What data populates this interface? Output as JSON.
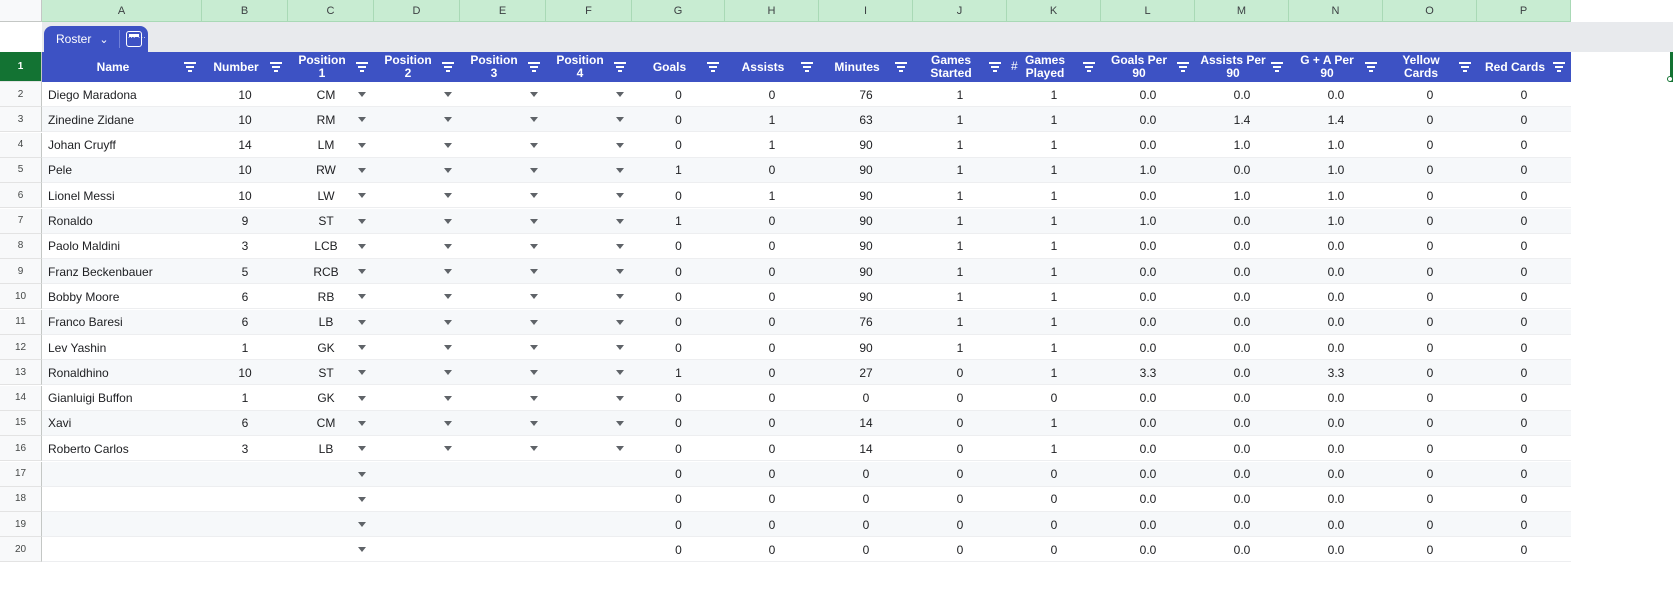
{
  "columns": [
    {
      "letter": "A",
      "header": "Name",
      "width": 160,
      "align": "left"
    },
    {
      "letter": "B",
      "header": "Number",
      "width": 86,
      "align": "center"
    },
    {
      "letter": "C",
      "header": "Position\n1",
      "width": 86,
      "align": "center",
      "dropdown": true
    },
    {
      "letter": "D",
      "header": "Position\n2",
      "width": 86,
      "align": "center",
      "dropdown": true
    },
    {
      "letter": "E",
      "header": "Position\n3",
      "width": 86,
      "align": "center",
      "dropdown": true
    },
    {
      "letter": "F",
      "header": "Position\n4",
      "width": 86,
      "align": "center",
      "dropdown": true
    },
    {
      "letter": "G",
      "header": "Goals",
      "width": 93,
      "align": "center"
    },
    {
      "letter": "H",
      "header": "Assists",
      "width": 94,
      "align": "center"
    },
    {
      "letter": "I",
      "header": "Minutes",
      "width": 94,
      "align": "center"
    },
    {
      "letter": "J",
      "header": "Games\nStarted",
      "width": 94,
      "align": "center"
    },
    {
      "letter": "K",
      "header": "Games\nPlayed",
      "width": 94,
      "align": "center",
      "hash": true
    },
    {
      "letter": "L",
      "header": "Goals Per\n90",
      "width": 94,
      "align": "center"
    },
    {
      "letter": "M",
      "header": "Assists Per\n90",
      "width": 94,
      "align": "center"
    },
    {
      "letter": "N",
      "header": "G + A Per\n90",
      "width": 94,
      "align": "center"
    },
    {
      "letter": "O",
      "header": "Yellow\nCards",
      "width": 94,
      "align": "center"
    },
    {
      "letter": "P",
      "header": "Red Cards",
      "width": 94,
      "align": "center"
    }
  ],
  "table": {
    "name": "Roster"
  },
  "rows": [
    [
      "Diego Maradona",
      "10",
      "CM",
      "",
      "",
      "",
      "0",
      "0",
      "76",
      "1",
      "1",
      "0.0",
      "0.0",
      "0.0",
      "0",
      "0"
    ],
    [
      "Zinedine Zidane",
      "10",
      "RM",
      "",
      "",
      "",
      "0",
      "1",
      "63",
      "1",
      "1",
      "0.0",
      "1.4",
      "1.4",
      "0",
      "0"
    ],
    [
      "Johan Cruyff",
      "14",
      "LM",
      "",
      "",
      "",
      "0",
      "1",
      "90",
      "1",
      "1",
      "0.0",
      "1.0",
      "1.0",
      "0",
      "0"
    ],
    [
      "Pele",
      "10",
      "RW",
      "",
      "",
      "",
      "1",
      "0",
      "90",
      "1",
      "1",
      "1.0",
      "0.0",
      "1.0",
      "0",
      "0"
    ],
    [
      "Lionel Messi",
      "10",
      "LW",
      "",
      "",
      "",
      "0",
      "1",
      "90",
      "1",
      "1",
      "0.0",
      "1.0",
      "1.0",
      "0",
      "0"
    ],
    [
      "Ronaldo",
      "9",
      "ST",
      "",
      "",
      "",
      "1",
      "0",
      "90",
      "1",
      "1",
      "1.0",
      "0.0",
      "1.0",
      "0",
      "0"
    ],
    [
      "Paolo Maldini",
      "3",
      "LCB",
      "",
      "",
      "",
      "0",
      "0",
      "90",
      "1",
      "1",
      "0.0",
      "0.0",
      "0.0",
      "0",
      "0"
    ],
    [
      "Franz Beckenbauer",
      "5",
      "RCB",
      "",
      "",
      "",
      "0",
      "0",
      "90",
      "1",
      "1",
      "0.0",
      "0.0",
      "0.0",
      "0",
      "0"
    ],
    [
      "Bobby Moore",
      "6",
      "RB",
      "",
      "",
      "",
      "0",
      "0",
      "90",
      "1",
      "1",
      "0.0",
      "0.0",
      "0.0",
      "0",
      "0"
    ],
    [
      "Franco Baresi",
      "6",
      "LB",
      "",
      "",
      "",
      "0",
      "0",
      "76",
      "1",
      "1",
      "0.0",
      "0.0",
      "0.0",
      "0",
      "0"
    ],
    [
      "Lev Yashin",
      "1",
      "GK",
      "",
      "",
      "",
      "0",
      "0",
      "90",
      "1",
      "1",
      "0.0",
      "0.0",
      "0.0",
      "0",
      "0"
    ],
    [
      "Ronaldhino",
      "10",
      "ST",
      "",
      "",
      "",
      "1",
      "0",
      "27",
      "0",
      "1",
      "3.3",
      "0.0",
      "3.3",
      "0",
      "0"
    ],
    [
      "Gianluigi Buffon",
      "1",
      "GK",
      "",
      "",
      "",
      "0",
      "0",
      "0",
      "0",
      "0",
      "0.0",
      "0.0",
      "0.0",
      "0",
      "0"
    ],
    [
      "Xavi",
      "6",
      "CM",
      "",
      "",
      "",
      "0",
      "0",
      "14",
      "0",
      "1",
      "0.0",
      "0.0",
      "0.0",
      "0",
      "0"
    ],
    [
      "Roberto Carlos",
      "3",
      "LB",
      "",
      "",
      "",
      "0",
      "0",
      "14",
      "0",
      "1",
      "0.0",
      "0.0",
      "0.0",
      "0",
      "0"
    ],
    [
      "",
      "",
      "",
      "",
      "",
      "",
      "0",
      "0",
      "0",
      "0",
      "0",
      "0.0",
      "0.0",
      "0.0",
      "0",
      "0"
    ],
    [
      "",
      "",
      "",
      "",
      "",
      "",
      "0",
      "0",
      "0",
      "0",
      "0",
      "0.0",
      "0.0",
      "0.0",
      "0",
      "0"
    ],
    [
      "",
      "",
      "",
      "",
      "",
      "",
      "0",
      "0",
      "0",
      "0",
      "0",
      "0.0",
      "0.0",
      "0.0",
      "0",
      "0"
    ],
    [
      "",
      "",
      "",
      "",
      "",
      "",
      "0",
      "0",
      "0",
      "0",
      "0",
      "0.0",
      "0.0",
      "0.0",
      "0",
      "0"
    ]
  ],
  "row_numbers": [
    "1",
    "2",
    "3",
    "4",
    "5",
    "6",
    "7",
    "8",
    "9",
    "10",
    "11",
    "12",
    "13",
    "14",
    "15",
    "16",
    "17",
    "18",
    "19",
    "20"
  ],
  "colors": {
    "header_bg": "#3d52c4",
    "col_letter_bg": "#c8ecd2",
    "active_row": "#137333"
  }
}
